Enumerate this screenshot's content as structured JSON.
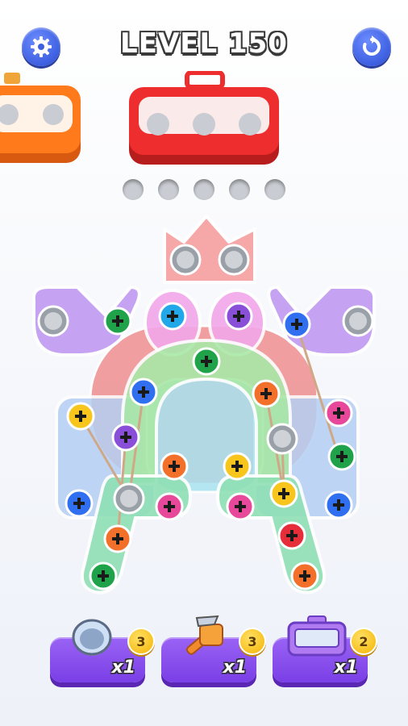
{
  "header": {
    "level_label": "LEVEL 150",
    "settings_icon": "gear-icon",
    "restart_icon": "restart-icon"
  },
  "boxes": [
    {
      "color": "#ff7a1a",
      "name": "orange-box"
    },
    {
      "color": "#ee2e2e",
      "name": "red-box"
    }
  ],
  "slots_count": 5,
  "boosters": [
    {
      "name": "hole-booster",
      "icon": "hole-icon",
      "count": "x1",
      "badge": "3"
    },
    {
      "name": "hammer-booster",
      "icon": "hammer-icon",
      "count": "x1",
      "badge": "3"
    },
    {
      "name": "toolbox-booster",
      "icon": "toolbox-icon",
      "count": "x1",
      "badge": "2"
    }
  ],
  "colors": {
    "screw_blue": "#2f6ff0",
    "screw_green": "#1fa24a",
    "screw_yellow": "#f7c51b",
    "screw_orange": "#f2702a",
    "screw_pink": "#e8489a",
    "screw_purple": "#8a4fd8",
    "screw_red": "#e52e3a"
  }
}
